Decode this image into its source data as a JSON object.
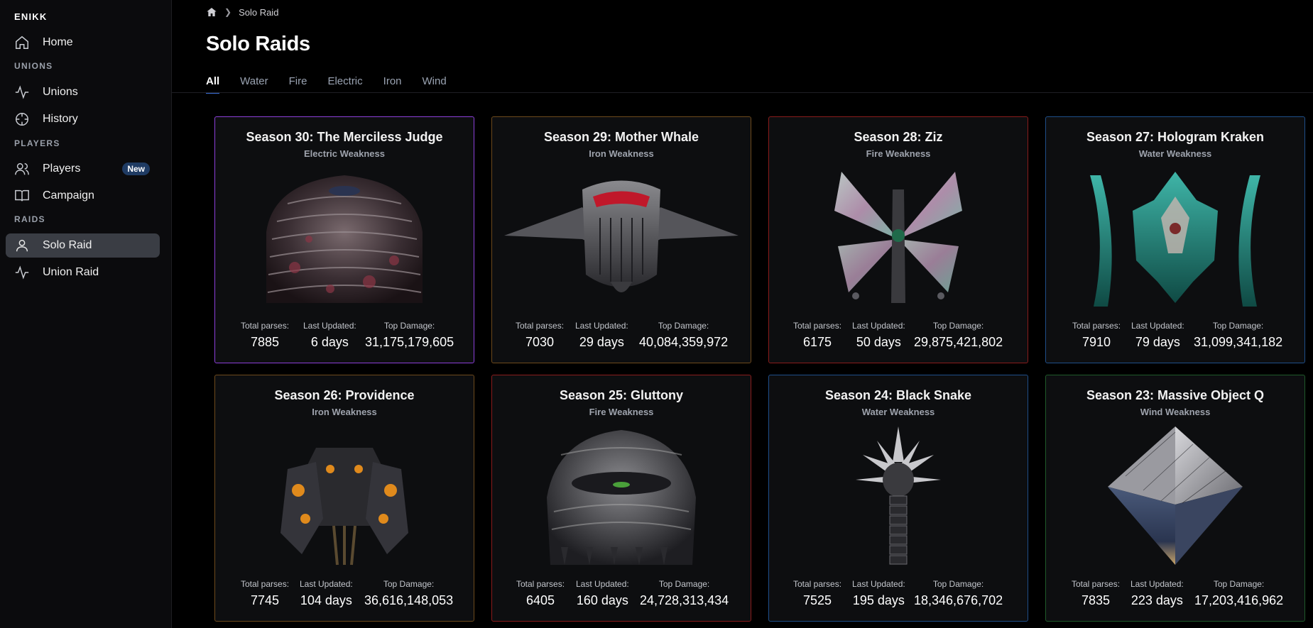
{
  "sidebar": {
    "brand": "ENIKK",
    "home": "Home",
    "unions_section": "UNIONS",
    "unions": "Unions",
    "history": "History",
    "players_section": "PLAYERS",
    "players": "Players",
    "players_badge": "New",
    "campaign": "Campaign",
    "raids_section": "RAIDS",
    "solo_raid": "Solo Raid",
    "union_raid": "Union Raid"
  },
  "breadcrumb": {
    "current": "Solo Raid"
  },
  "page_title": "Solo Raids",
  "tabs": [
    "All",
    "Water",
    "Fire",
    "Electric",
    "Iron",
    "Wind"
  ],
  "stat_labels": {
    "parses": "Total parses:",
    "updated": "Last Updated:",
    "damage": "Top Damage:"
  },
  "colors": {
    "electric": "#8b3fd9",
    "iron": "#6e4a1c",
    "fire": "#8a1c1c",
    "water": "#1f4f8a",
    "wind": "#1f5a2a",
    "accent": "#3b6fd8"
  },
  "raids": [
    {
      "title": "Season 30: The Merciless Judge",
      "weakness": "Electric Weakness",
      "parses": "7885",
      "updated": "6 days",
      "damage": "31,175,179,605"
    },
    {
      "title": "Season 29: Mother Whale",
      "weakness": "Iron Weakness",
      "parses": "7030",
      "updated": "29 days",
      "damage": "40,084,359,972"
    },
    {
      "title": "Season 28: Ziz",
      "weakness": "Fire Weakness",
      "parses": "6175",
      "updated": "50 days",
      "damage": "29,875,421,802"
    },
    {
      "title": "Season 27: Hologram Kraken",
      "weakness": "Water Weakness",
      "parses": "7910",
      "updated": "79 days",
      "damage": "31,099,341,182"
    },
    {
      "title": "Season 26: Providence",
      "weakness": "Iron Weakness",
      "parses": "7745",
      "updated": "104 days",
      "damage": "36,616,148,053"
    },
    {
      "title": "Season 25: Gluttony",
      "weakness": "Fire Weakness",
      "parses": "6405",
      "updated": "160 days",
      "damage": "24,728,313,434"
    },
    {
      "title": "Season 24: Black Snake",
      "weakness": "Water Weakness",
      "parses": "7525",
      "updated": "195 days",
      "damage": "18,346,676,702"
    },
    {
      "title": "Season 23: Massive Object Q",
      "weakness": "Wind Weakness",
      "parses": "7835",
      "updated": "223 days",
      "damage": "17,203,416,962"
    }
  ]
}
